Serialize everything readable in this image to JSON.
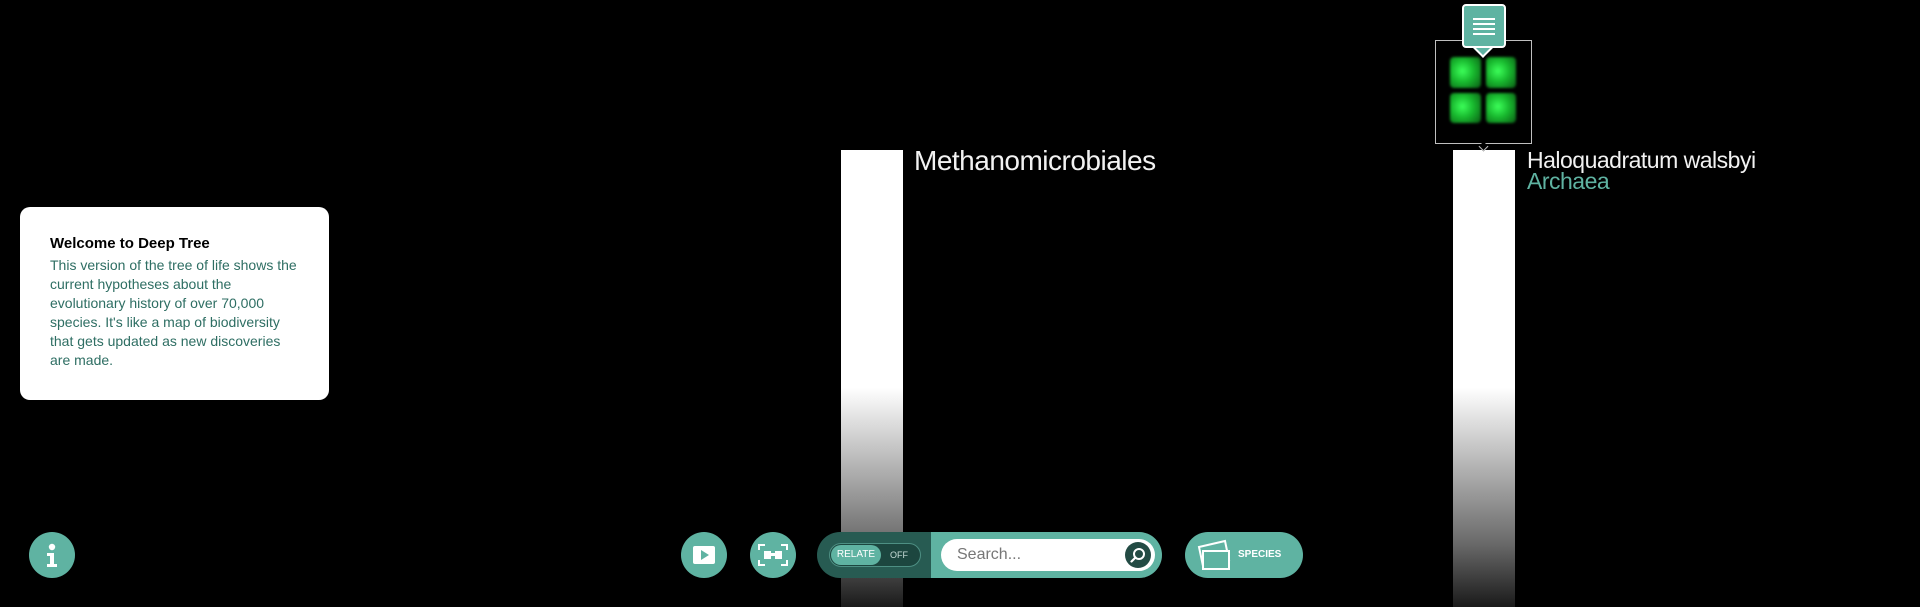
{
  "tree": {
    "left_node": {
      "label": "Methanomicrobiales"
    },
    "right_node": {
      "species": "Haloquadratum walsbyi",
      "domain": "Archaea"
    }
  },
  "thumbnail": {
    "icon": "microbe-image"
  },
  "info_tag": {
    "icon": "text-lines-icon"
  },
  "welcome": {
    "title": "Welcome to Deep Tree",
    "body": "This version of the tree of life shows the current hypotheses about the evolutionary history of over 70,000 species. It's like a map of biodiversity that gets updated as new discoveries are made."
  },
  "controls": {
    "info_icon": "info-icon",
    "play_icon": "play-icon",
    "fit_icon": "fit-screen-icon",
    "relate": {
      "on_label": "RELATE",
      "off_label": "OFF"
    },
    "search": {
      "placeholder": "Search...",
      "value": ""
    },
    "species_label": "SPECIES"
  },
  "colors": {
    "accent": "#5fb3a2",
    "accent_dark": "#275b52",
    "background": "#000000"
  }
}
